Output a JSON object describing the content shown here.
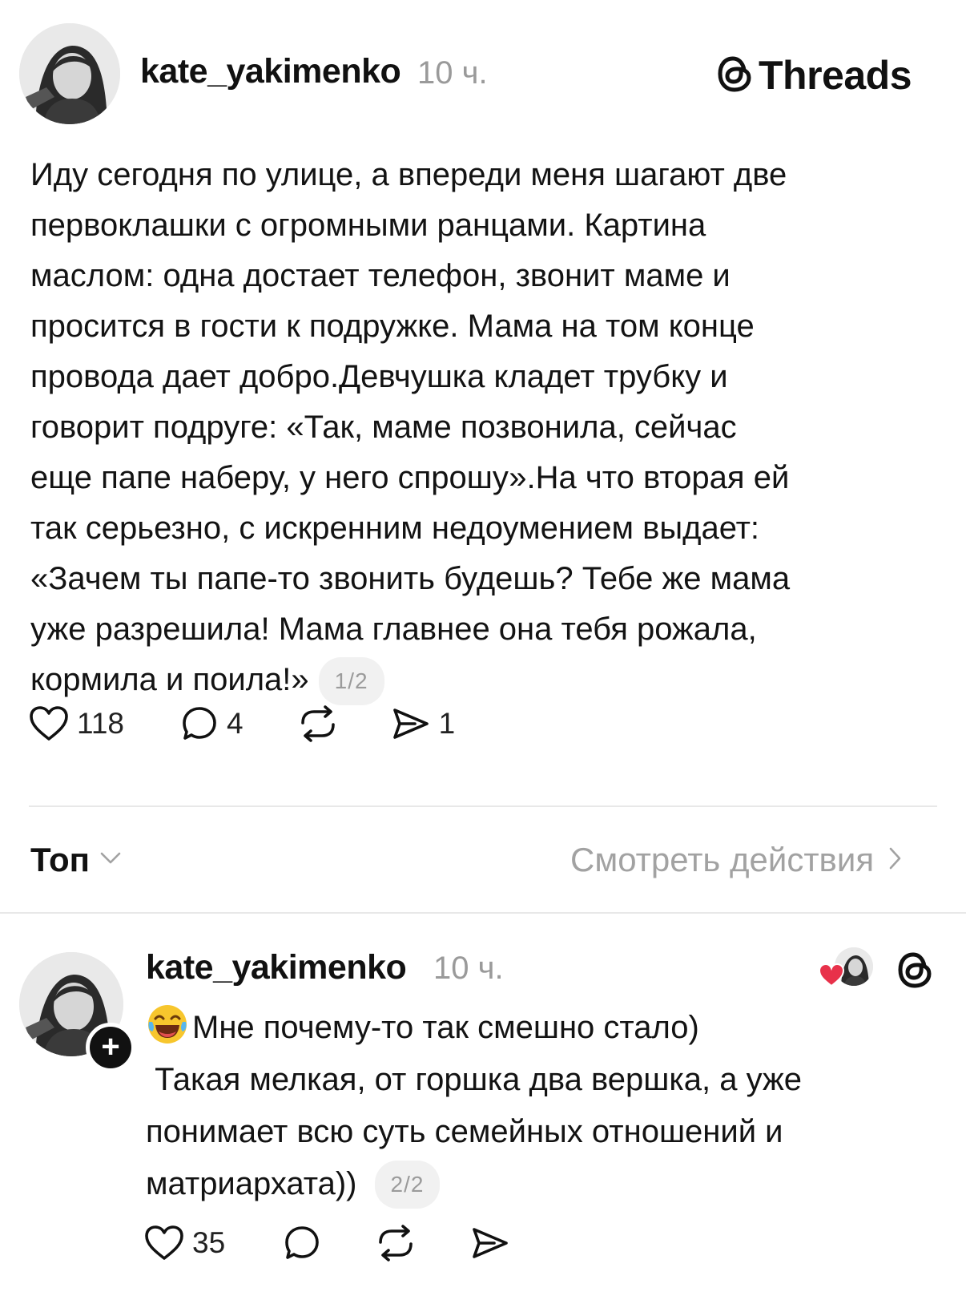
{
  "post": {
    "username": "kate_yakimenko",
    "time": "10 ч.",
    "brand": "Threads",
    "text": "Иду сегодня по улице, а впереди меня шагают две\nпервоклашки с огромными ранцами. Картина\nмаслом: одна достает телефон, звонит маме и\nпросится в гости к подружке. Мама на том конце\nпровода дает добро.Девчушка кладет трубку и\nговорит подруге: «Так, маме позвонила, сейчас\nеще папе наберу, у него спрошу».На что вторая ей\nтак серьезно, с искренним недоумением выдает:\n«Зачем ты папе-то звонить будешь? Тебе же мама\nуже разрешила! Мама главнее она тебя рожала,\nкормила и поила!»",
    "pager": "1/2",
    "likes": "118",
    "comments": "4",
    "shares": "1",
    "icons": [
      "heart-icon",
      "comment-icon",
      "repost-icon",
      "send-icon"
    ]
  },
  "comments_bar": {
    "sort_label": "Топ",
    "activity_link": "Смотреть действия"
  },
  "reply": {
    "username": "kate_yakimenko",
    "time": "10 ч.",
    "emoji": "😂",
    "lines": [
      "Мне почему-то так смешно стало)",
      " Такая мелкая, от горшка два вершка, а уже",
      "понимает всю суть семейных отношений и",
      "матриархата))"
    ],
    "pager": "2/2",
    "likes": "35",
    "icons": [
      "heart-icon",
      "comment-icon",
      "repost-icon",
      "send-icon"
    ]
  },
  "colors": {
    "like_heart": "#e8314a",
    "muted_text": "#9a9a9a",
    "text": "#131313"
  }
}
